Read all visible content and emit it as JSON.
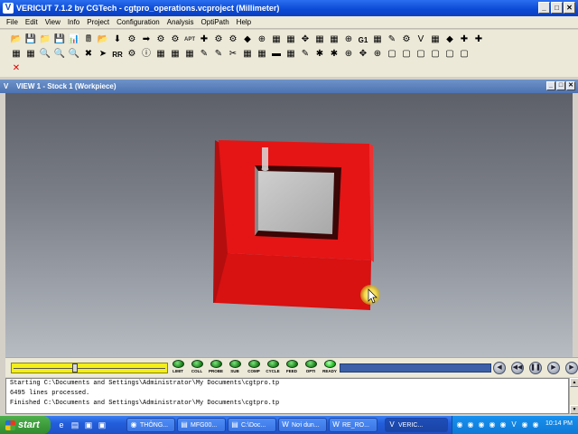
{
  "window": {
    "title": "VERICUT 7.1.2 by CGTech - cgtpro_operations.vcproject (Millimeter)",
    "app_icon": "V"
  },
  "menu": {
    "items": [
      "File",
      "Edit",
      "View",
      "Info",
      "Project",
      "Configuration",
      "Analysis",
      "OptiPath",
      "Help"
    ]
  },
  "toolbar": {
    "row1": [
      "📂",
      "💾",
      "📁",
      "💾",
      "📊",
      "🖩",
      "📂",
      "⬇",
      "⚙",
      "➡",
      "⚙",
      "⚙",
      "APT",
      "✚",
      "⚙",
      "⚙",
      "◆",
      "⊕",
      "▦",
      "▦",
      "✥",
      "▦",
      "▦",
      "⊕",
      "G1",
      "▦",
      "✎",
      "⚙",
      "V",
      "▦",
      "◆",
      "✚",
      "✚"
    ],
    "row2": [
      "▦",
      "▦",
      "🔍",
      "🔍",
      "🔍",
      "✖",
      "➤",
      "RR",
      "⚙",
      "ⓘ",
      "▦",
      "▦",
      "▦",
      "✎",
      "✎",
      "✂",
      "▦",
      "▦",
      "▬",
      "▦",
      "✎",
      "✱",
      "✱",
      "⊕",
      "✥",
      "⊕",
      "▢",
      "▢",
      "▢",
      "▢",
      "▢",
      "▢"
    ],
    "row3": [
      "✕"
    ]
  },
  "view": {
    "title": "VIEW 1 - Stock 1 (Workpiece)",
    "icon": "V"
  },
  "anim": {
    "slider_position": 0.4,
    "leds": [
      {
        "label": "LIMIT"
      },
      {
        "label": "COLL"
      },
      {
        "label": "PROBE"
      },
      {
        "label": "SUB"
      },
      {
        "label": "COMP"
      },
      {
        "label": "CYCLE"
      },
      {
        "label": "FEED"
      },
      {
        "label": "OPTI"
      },
      {
        "label": "READY"
      }
    ],
    "progress": 1.0
  },
  "log": {
    "lines": [
      "Starting C:\\Documents and Settings\\Administrator\\My Documents\\cgtpro.tp",
      "6495 lines processed.",
      "Finished C:\\Documents and Settings\\Administrator\\My Documents\\cgtpro.tp"
    ]
  },
  "taskbar": {
    "start_label": "start",
    "tasks": [
      {
        "label": "THÔNG...",
        "icon": "chrome-icon"
      },
      {
        "label": "MFG00...",
        "icon": "folder-icon"
      },
      {
        "label": "C:\\Doc...",
        "icon": "folder-icon"
      },
      {
        "label": "Nơi dun...",
        "icon": "word-icon"
      },
      {
        "label": "RE_RO...",
        "icon": "word-icon"
      },
      {
        "label": "VERIC...",
        "icon": "vericut-icon"
      }
    ],
    "clock": "10:14 PM"
  },
  "colors": {
    "stock_red": "#e11414",
    "pocket_grey": "#bcbcbc",
    "progress_blue": "#3d60a8",
    "slider_yellow": "#f4ef18"
  }
}
